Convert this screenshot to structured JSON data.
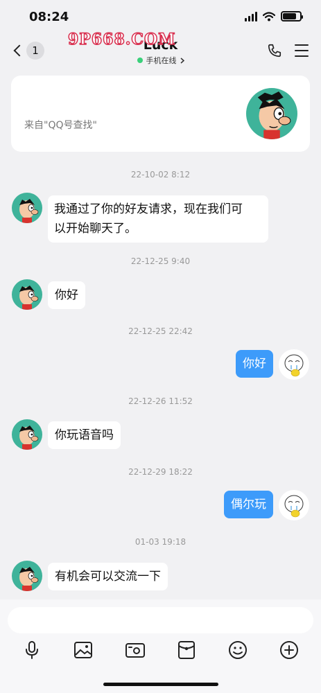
{
  "status_bar": {
    "time": "08:24"
  },
  "header": {
    "back_count": "1",
    "title": "Luck",
    "presence": "手机在线",
    "watermark": "9P668.COM"
  },
  "source_card": {
    "text": "来自\"QQ号查找\""
  },
  "messages": [
    {
      "timestamp": "22-10-02 8:12",
      "sender": "friend",
      "text_lines": [
        "我通过了你的好友请求，现在我们可",
        "以开始聊天了。"
      ]
    },
    {
      "timestamp": "22-12-25 9:40",
      "sender": "friend",
      "text": "你好"
    },
    {
      "timestamp": "22-12-25 22:42",
      "sender": "self",
      "text": "你好"
    },
    {
      "timestamp": "22-12-26 11:52",
      "sender": "friend",
      "text": "你玩语音吗"
    },
    {
      "timestamp": "22-12-29 18:22",
      "sender": "self",
      "text": "偶尔玩"
    },
    {
      "timestamp": "01-03 19:18",
      "sender": "friend",
      "text": "有机会可以交流一下"
    }
  ],
  "input": {
    "placeholder": ""
  },
  "toolbar": [
    "microphone-icon",
    "image-icon",
    "camera-icon",
    "red-packet-icon",
    "emoji-icon",
    "plus-icon"
  ],
  "colors": {
    "self_bubble": "#3d9bfa",
    "online": "#3ad07a",
    "background": "#f1f1f3"
  }
}
